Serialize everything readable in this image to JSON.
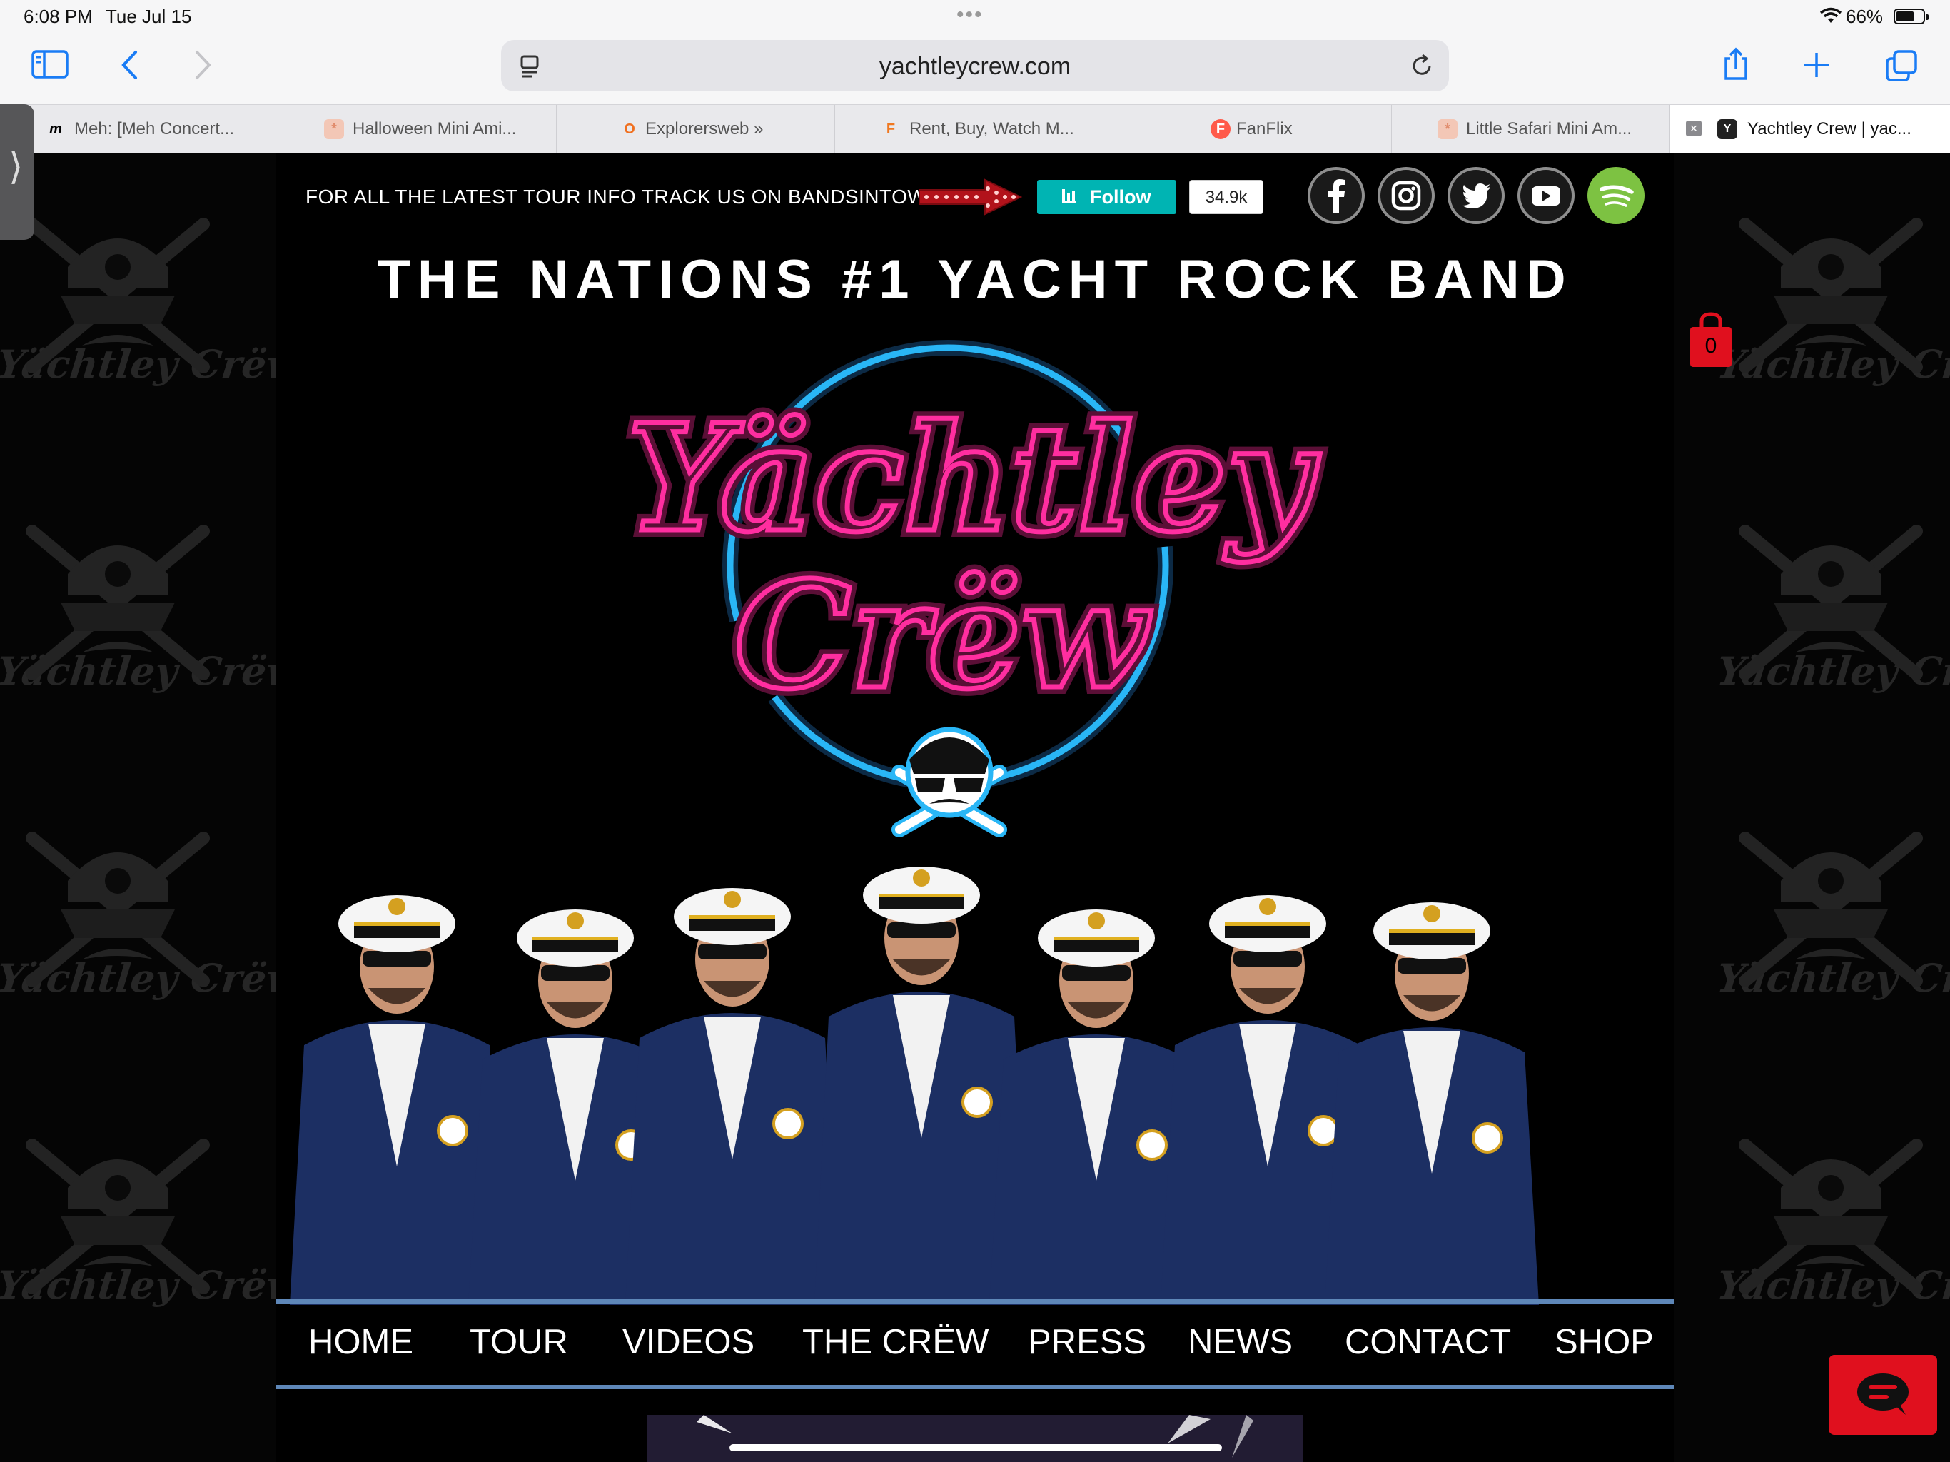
{
  "status_bar": {
    "time": "6:08 PM",
    "date": "Tue Jul 15",
    "battery": "66%",
    "battery_level": 0.66
  },
  "browser": {
    "url": "yachtleycrew.com",
    "tabs": [
      {
        "label": "Meh: [Meh Concert...",
        "favicon": "m",
        "favicon_color": "#000000"
      },
      {
        "label": "Halloween Mini Ami...",
        "favicon": "*",
        "favicon_color": "#e08a6a"
      },
      {
        "label": "Explorersweb »",
        "favicon": "O",
        "favicon_color": "#f07020"
      },
      {
        "label": "Rent, Buy, Watch M...",
        "favicon": "F",
        "favicon_color": "#f07820"
      },
      {
        "label": "FanFlix",
        "favicon": "F",
        "favicon_color": "#ff5a4a"
      },
      {
        "label": "Little Safari Mini Am...",
        "favicon": "*",
        "favicon_color": "#e08a6a"
      },
      {
        "label": "Yachtley Crew | yac...",
        "favicon": "Y",
        "favicon_color": "#222222",
        "active": true
      }
    ]
  },
  "site": {
    "tour_info": "FOR ALL THE LATEST TOUR INFO TRACK US ON BANDSINTOWN",
    "follow_label": "Follow",
    "follow_count": "34.9k",
    "social": [
      "facebook-icon",
      "instagram-icon",
      "twitter-icon",
      "youtube-icon",
      "spotify-icon"
    ],
    "tagline": "THE NATIONS #1 YACHT ROCK BAND",
    "logo_text": [
      "Yächtley",
      "Crëw"
    ],
    "watermark": "Yächtley Crëw",
    "cart_count": "0",
    "nav": [
      "HOME",
      "TOUR",
      "VIDEOS",
      "THE CRËW",
      "PRESS",
      "NEWS",
      "CONTACT",
      "SHOP"
    ],
    "colors": {
      "accent_teal": "#00b4b3",
      "neon_pink": "#ff2ea0",
      "neon_blue": "#29b6f6",
      "nav_line": "#5e87b8",
      "cart_red": "#e0101e",
      "spotify": "#7dc242"
    }
  }
}
